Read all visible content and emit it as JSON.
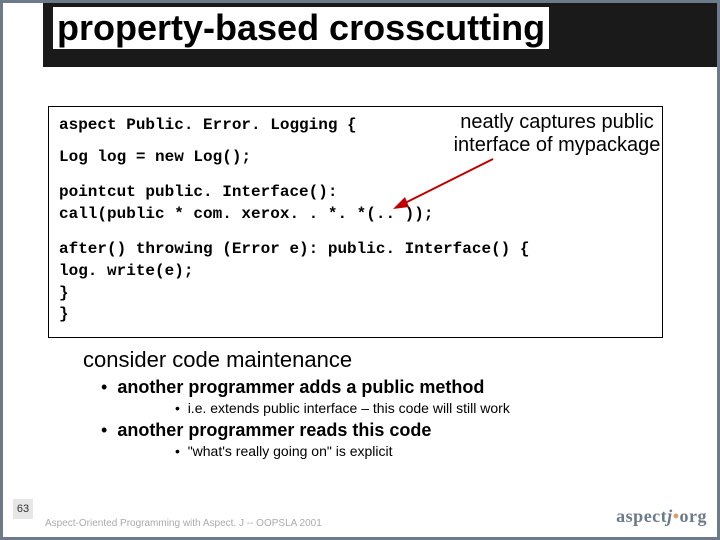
{
  "title": "property-based crosscutting",
  "callout": {
    "line1": "neatly captures public",
    "line2": "interface of mypackage"
  },
  "code": {
    "l1a": "aspect",
    "l1b": " Public. Error. Logging {",
    "l2a": "  Log log = ",
    "l2b": "new",
    "l2c": " Log();",
    "l3a": "  pointcut",
    "l3b": " public. Interface():",
    "l4": "    call(public * com. xerox. . *. *(.. ));",
    "l5": "  after() throwing (Error e): public. Interface() {",
    "l6": "    log. write(e);",
    "l7": "  }",
    "l8": "}"
  },
  "notes": {
    "heading": "consider code maintenance",
    "b1a": "another programmer adds a public method",
    "b2a": "i.e. extends public interface – this code will still work",
    "b1b": "another programmer reads this code",
    "b2b": "\"what's really going on\" is explicit"
  },
  "slide_number": "63",
  "footer": "Aspect-Oriented Programming with Aspect. J -- OOPSLA 2001",
  "logo": {
    "a": "aspect",
    "j": "j",
    "dot": "•",
    "org": "org"
  }
}
